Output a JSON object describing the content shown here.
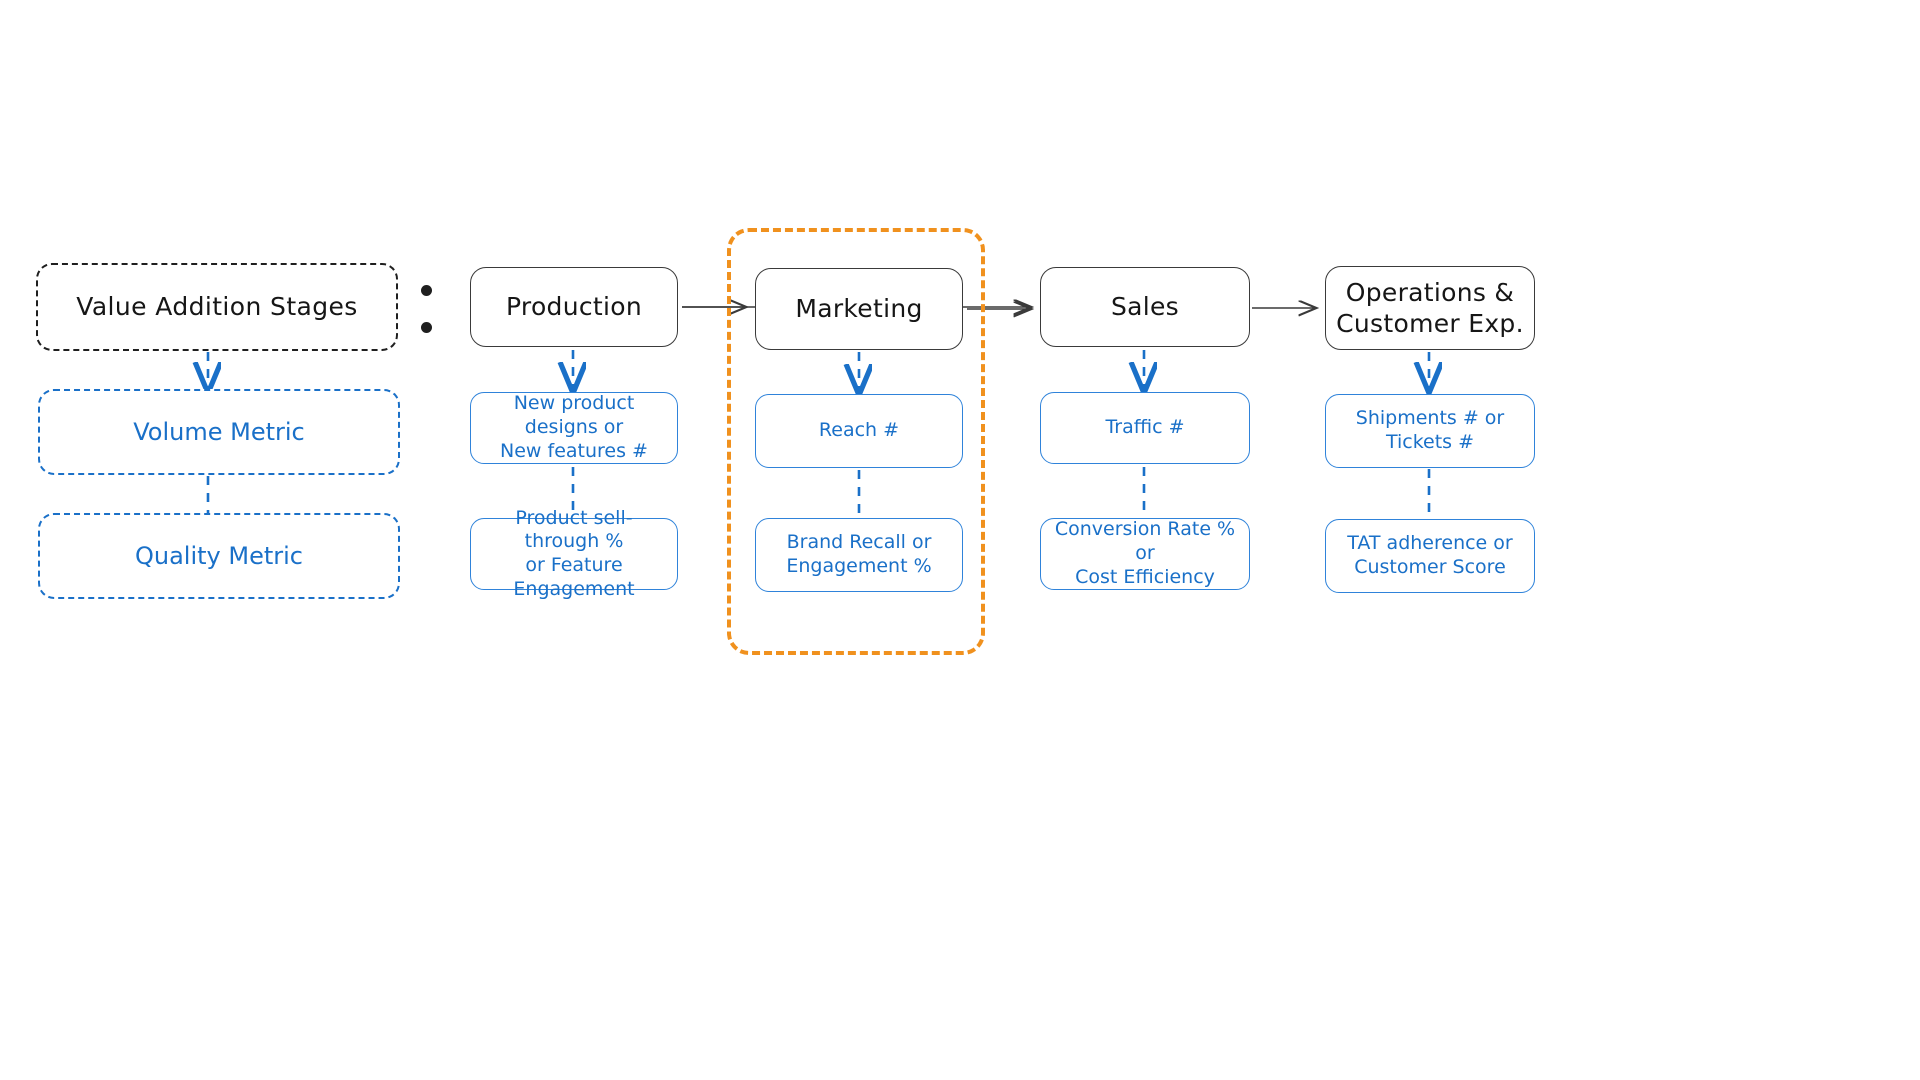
{
  "legend": {
    "header": "Value Addition Stages",
    "metrics": [
      {
        "label": "Volume Metric"
      },
      {
        "label": "Quality Metric"
      }
    ],
    "separator": "colon"
  },
  "colors": {
    "stage_border": "#3a3a3a",
    "stage_text": "#161616",
    "metric_blue": "#1a70c8",
    "metric_border": "#2f83da",
    "highlight_orange": "#f0911e",
    "background": "#ffffff"
  },
  "highlight": {
    "target_stage": "Marketing"
  },
  "chart_data": {
    "type": "flow-diagram",
    "title": "Value Addition Stages",
    "orientation": "left-to-right",
    "stages": [
      {
        "name": "Production",
        "volume_metric": "New product designs or\nNew features #",
        "quality_metric": "Product sell-through %\nor Feature Engagement",
        "highlighted": false
      },
      {
        "name": "Marketing",
        "volume_metric": "Reach #",
        "quality_metric": "Brand Recall or\nEngagement %",
        "highlighted": true
      },
      {
        "name": "Sales",
        "volume_metric": "Traffic #",
        "quality_metric": "Conversion Rate % or\nCost Efficiency",
        "highlighted": false
      },
      {
        "name": "Operations &\nCustomer Exp.",
        "volume_metric": "Shipments # or\nTickets #",
        "quality_metric": "TAT adherence or\nCustomer Score",
        "highlighted": false
      }
    ]
  }
}
